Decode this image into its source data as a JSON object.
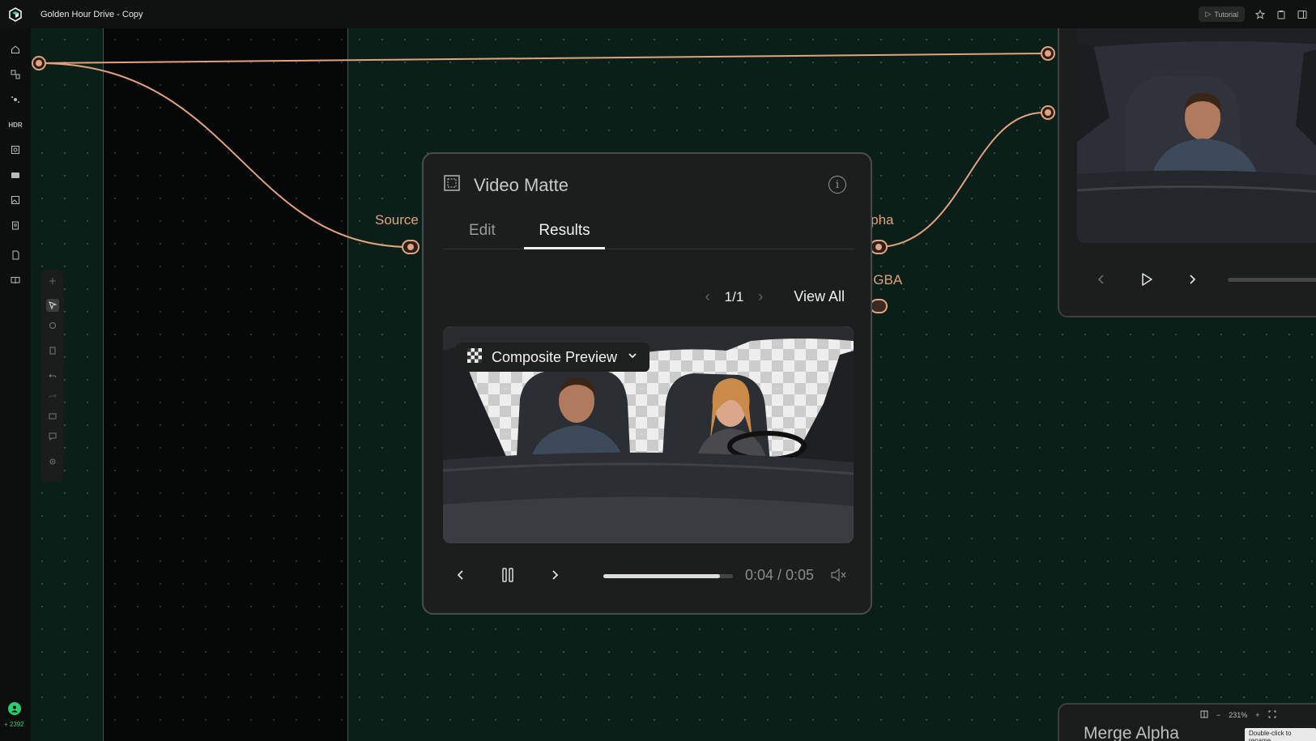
{
  "app": {
    "doc_title": "Golden Hour Drive - Copy",
    "tutorial_label": "Tutorial"
  },
  "sidebar": {
    "items": [
      "home",
      "flow",
      "effects",
      "HDR",
      "frame",
      "camera",
      "gallery",
      "clipboard",
      "report",
      "book"
    ],
    "credits": "2392"
  },
  "node": {
    "title": "Video Matte",
    "tabs": [
      {
        "label": "Edit"
      },
      {
        "label": "Results"
      }
    ],
    "active_tab": "Results",
    "pager": {
      "count": "1/1",
      "view_all": "View All"
    },
    "preview_mode": "Composite Preview",
    "playback": {
      "time": "0:04 / 0:05",
      "progress": 0.9
    }
  },
  "ports": {
    "source": "Source *",
    "alpha": "Alpha",
    "rgba": "RGBA"
  },
  "merge_node": {
    "title": "Merge Alpha"
  },
  "zoom": {
    "level": "231%",
    "tooltip": "Double-click to rename"
  },
  "colors": {
    "accent": "#e2a27f",
    "canvas": "#0a1f17",
    "credits": "#2ecc71"
  }
}
